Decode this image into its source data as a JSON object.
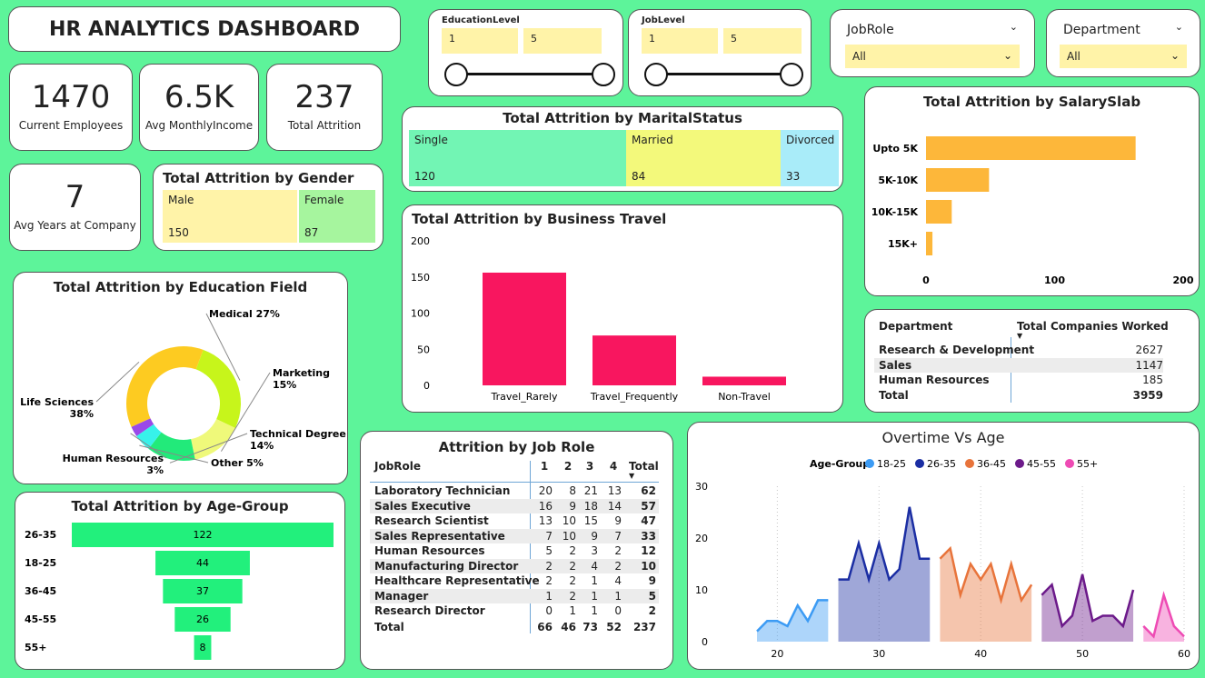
{
  "header": {
    "title": "HR ANALYTICS DASHBOARD"
  },
  "kpis": {
    "employees": {
      "value": "1470",
      "label": "Current Employees"
    },
    "income": {
      "value": "6.5K",
      "label": "Avg MonthlyIncome"
    },
    "attrition": {
      "value": "237",
      "label": "Total Attrition"
    },
    "years": {
      "value": "7",
      "label": "Avg Years at Company"
    }
  },
  "filters": {
    "education": {
      "label": "EducationLevel",
      "min": "1",
      "max": "5"
    },
    "joblevel": {
      "label": "JobLevel",
      "min": "1",
      "max": "5"
    },
    "jobrole": {
      "label": "JobRole",
      "value": "All"
    },
    "department": {
      "label": "Department",
      "value": "All"
    }
  },
  "gender": {
    "title": "Total Attrition by Gender",
    "items": [
      {
        "label": "Male",
        "value": "150",
        "color": "#fff3a8"
      },
      {
        "label": "Female",
        "value": "87",
        "color": "#a6f59e"
      }
    ]
  },
  "marital": {
    "title": "Total Attrition by MaritalStatus",
    "items": [
      {
        "label": "Single",
        "value": "120",
        "color": "#72f5b4"
      },
      {
        "label": "Married",
        "value": "84",
        "color": "#f3f97b"
      },
      {
        "label": "Divorced",
        "value": "33",
        "color": "#a9ecf9"
      }
    ]
  },
  "salary": {
    "title": "Total Attrition by SalarySlab",
    "categories": [
      "Upto 5K",
      "5K-10K",
      "10K-15K",
      "15K+"
    ],
    "values": [
      163,
      49,
      20,
      5
    ],
    "ticks": [
      "0",
      "100",
      "200"
    ],
    "color": "#fdb73a"
  },
  "travel": {
    "title": "Total Attrition by Business Travel",
    "categories": [
      "Travel_Rarely",
      "Travel_Frequently",
      "Non-Travel"
    ],
    "values": [
      156,
      69,
      12
    ],
    "ticks": [
      "0",
      "50",
      "100",
      "150",
      "200"
    ],
    "color": "#f8165f"
  },
  "education_field": {
    "title": "Total Attrition by Education Field",
    "slices": [
      {
        "label": "Medical 27%",
        "value": 27,
        "color": "#c7f51b"
      },
      {
        "label": "Marketing\n15%",
        "value": 15,
        "color": "#eff97a"
      },
      {
        "label": "Technical Degree\n14%",
        "value": 14,
        "color": "#22ea7a"
      },
      {
        "label": "Other 5%",
        "value": 5,
        "color": "#37f2ea"
      },
      {
        "label": "Human Resources\n3%",
        "value": 3,
        "color": "#9a49e9"
      },
      {
        "label": "Life Sciences\n38%",
        "value": 38,
        "color": "#fdcb21"
      }
    ]
  },
  "department_table": {
    "col1": "Department",
    "col2": "Total Companies Worked",
    "rows": [
      {
        "name": "Research & Development",
        "value": "2627"
      },
      {
        "name": "Sales",
        "value": "1147"
      },
      {
        "name": "Human Resources",
        "value": "185"
      }
    ],
    "total": {
      "name": "Total",
      "value": "3959"
    }
  },
  "agegroup": {
    "title": "Total Attrition by Age-Group",
    "categories": [
      "26-35",
      "18-25",
      "36-45",
      "45-55",
      "55+"
    ],
    "values": [
      122,
      44,
      37,
      26,
      8
    ],
    "color": "#22f07c"
  },
  "jobrole_table": {
    "title": "Attrition by Job Role",
    "headers": [
      "JobRole",
      "1",
      "2",
      "3",
      "4",
      "Total"
    ],
    "rows": [
      [
        "Laboratory Technician",
        "20",
        "8",
        "21",
        "13",
        "62"
      ],
      [
        "Sales Executive",
        "16",
        "9",
        "18",
        "14",
        "57"
      ],
      [
        "Research Scientist",
        "13",
        "10",
        "15",
        "9",
        "47"
      ],
      [
        "Sales Representative",
        "7",
        "10",
        "9",
        "7",
        "33"
      ],
      [
        "Human Resources",
        "5",
        "2",
        "3",
        "2",
        "12"
      ],
      [
        "Manufacturing Director",
        "2",
        "2",
        "4",
        "2",
        "10"
      ],
      [
        "Healthcare Representative",
        "2",
        "2",
        "1",
        "4",
        "9"
      ],
      [
        "Manager",
        "1",
        "2",
        "1",
        "1",
        "5"
      ],
      [
        "Research Director",
        "0",
        "1",
        "1",
        "0",
        "2"
      ]
    ],
    "total": [
      "Total",
      "66",
      "46",
      "73",
      "52",
      "237"
    ]
  },
  "overtime": {
    "title": "Overtime Vs Age",
    "legend_title": "Age-Group",
    "y_ticks": [
      "0",
      "10",
      "20",
      "30"
    ],
    "x_ticks": [
      "20",
      "30",
      "40",
      "50",
      "60"
    ],
    "chart_data": {
      "type": "area",
      "xlim": [
        18,
        60
      ],
      "ylim": [
        0,
        30
      ],
      "series": [
        {
          "name": "18-25",
          "color": "#3c9bf4",
          "x": [
            18,
            19,
            20,
            21,
            22,
            23,
            24,
            25
          ],
          "y": [
            2,
            4,
            4,
            3,
            7,
            4,
            8,
            8
          ]
        },
        {
          "name": "26-35",
          "color": "#1b2ea3",
          "x": [
            26,
            27,
            28,
            29,
            30,
            31,
            32,
            33,
            34,
            35
          ],
          "y": [
            12,
            12,
            19,
            12,
            19,
            12,
            14,
            26,
            16,
            16
          ]
        },
        {
          "name": "36-45",
          "color": "#e8743b",
          "x": [
            36,
            37,
            38,
            39,
            40,
            41,
            42,
            43,
            44,
            45
          ],
          "y": [
            16,
            18,
            9,
            15,
            12,
            15,
            8,
            15,
            8,
            11
          ]
        },
        {
          "name": "45-55",
          "color": "#6c1a8a",
          "x": [
            46,
            47,
            48,
            49,
            50,
            51,
            52,
            53,
            54,
            55
          ],
          "y": [
            9,
            11,
            3,
            5,
            13,
            4,
            5,
            5,
            3,
            10
          ]
        },
        {
          "name": "55+",
          "color": "#ee4bb4",
          "x": [
            56,
            57,
            58,
            59,
            60
          ],
          "y": [
            3,
            1,
            9,
            3,
            1
          ]
        }
      ]
    }
  }
}
